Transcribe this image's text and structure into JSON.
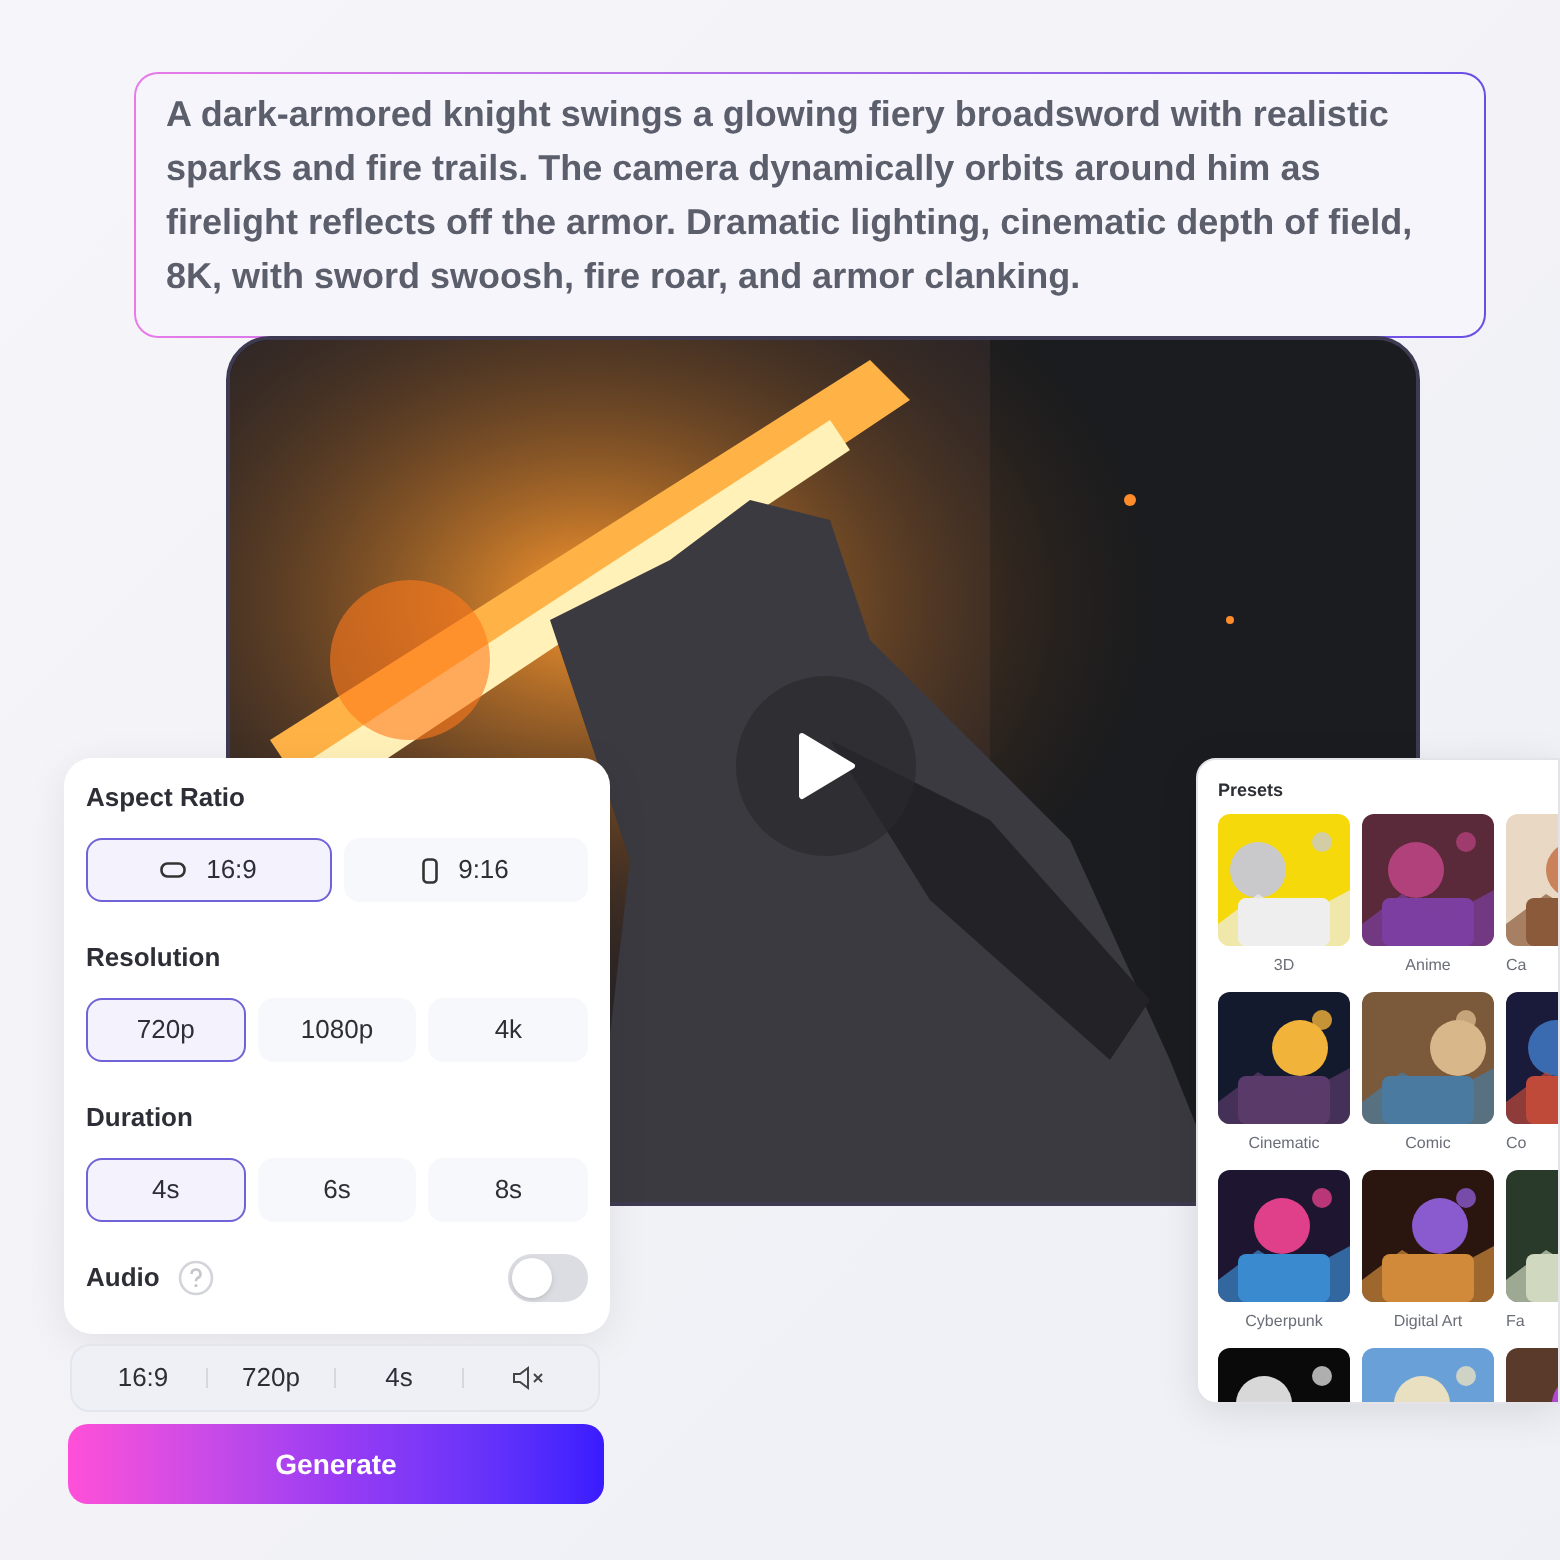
{
  "prompt": {
    "text": "A dark-armored knight swings a glowing fiery broadsword with realistic sparks and fire trails. The camera dynamically orbits around him as firelight reflects off the armor. Dramatic lighting, cinematic depth of field, 8K, with sword swoosh, fire roar, and armor clanking."
  },
  "video": {
    "kind": "picture",
    "playing": false
  },
  "settings": {
    "sections": [
      {
        "title": "Aspect Ratio",
        "kind": "options",
        "options": [
          {
            "label": "16:9",
            "selected": true
          },
          {
            "label": "9:16",
            "selected": false
          }
        ]
      },
      {
        "title": "Resolution",
        "kind": "options",
        "options": [
          {
            "label": "720p",
            "selected": true
          },
          {
            "label": "1080p",
            "selected": false
          },
          {
            "label": "4k",
            "selected": false
          }
        ]
      },
      {
        "title": "Duration",
        "kind": "options",
        "options": [
          {
            "label": "4s",
            "selected": true
          },
          {
            "label": "6s",
            "selected": false
          },
          {
            "label": "8s",
            "selected": false
          }
        ]
      },
      {
        "title": "Audio",
        "kind": "toggle",
        "on": false
      }
    ]
  },
  "summary": {
    "items": [
      "16:9",
      "720p",
      "4s"
    ],
    "muted": true
  },
  "generate_button": "Generate",
  "presets": {
    "title": "Presets",
    "items": [
      {
        "label": "3D",
        "kind": "labeled"
      },
      {
        "label": "Anime",
        "kind": "labeled"
      },
      {
        "label": "Ca",
        "kind": "labeled"
      },
      {
        "label": "Cinematic",
        "kind": "labeled"
      },
      {
        "label": "Comic",
        "kind": "labeled"
      },
      {
        "label": "Co",
        "kind": "labeled"
      },
      {
        "label": "Cyberpunk",
        "kind": "labeled"
      },
      {
        "label": "Digital Art",
        "kind": "labeled"
      },
      {
        "label": "Fa",
        "kind": "labeled"
      },
      {
        "kind": "picture"
      },
      {
        "kind": "picture"
      },
      {
        "kind": "picture"
      }
    ]
  }
}
